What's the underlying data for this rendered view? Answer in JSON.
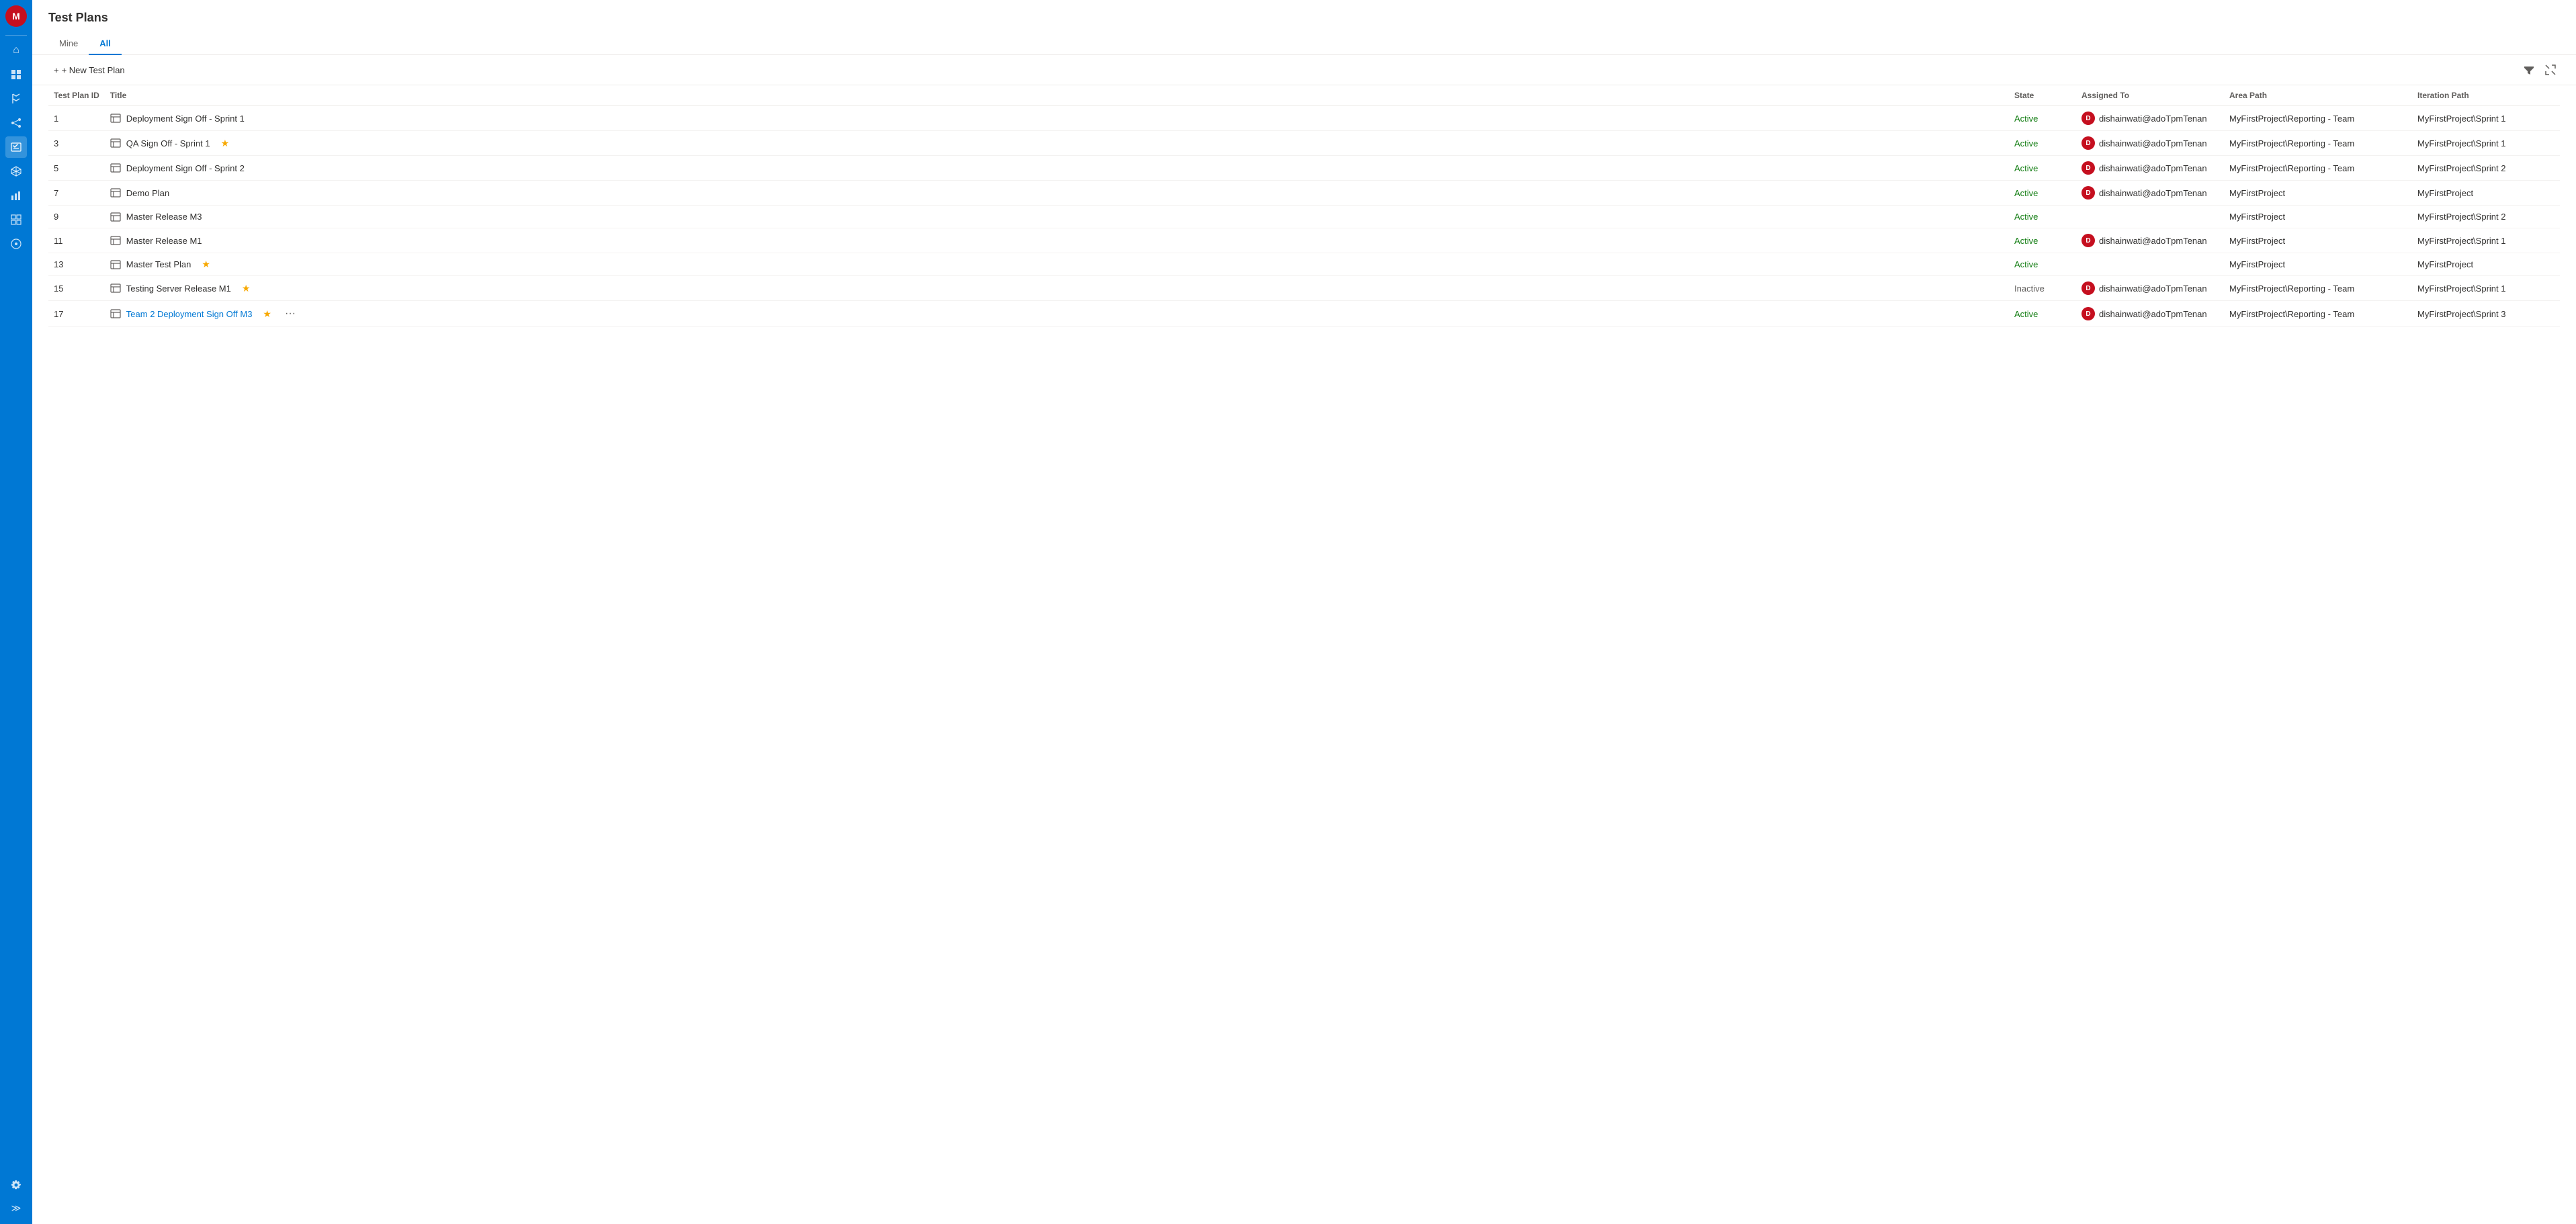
{
  "app": {
    "avatar_initials": "M",
    "page_title": "Test Plans"
  },
  "nav": {
    "icons": [
      {
        "name": "home-icon",
        "symbol": "⌂",
        "active": false
      },
      {
        "name": "boards-icon",
        "symbol": "▦",
        "active": false
      },
      {
        "name": "repos-icon",
        "symbol": "◈",
        "active": false
      },
      {
        "name": "pipelines-icon",
        "symbol": "⚙",
        "active": false
      },
      {
        "name": "testplans-icon",
        "symbol": "✓",
        "active": true
      },
      {
        "name": "artifacts-icon",
        "symbol": "⬡",
        "active": false
      },
      {
        "name": "reports-icon",
        "symbol": "⊞",
        "active": false
      },
      {
        "name": "overview-icon",
        "symbol": "⊟",
        "active": false
      },
      {
        "name": "wiki-icon",
        "symbol": "⊕",
        "active": false
      }
    ],
    "bottom_icons": [
      {
        "name": "settings-icon",
        "symbol": "⚙"
      },
      {
        "name": "expand-icon",
        "symbol": "≫"
      }
    ]
  },
  "tabs": [
    {
      "label": "Mine",
      "active": false
    },
    {
      "label": "All",
      "active": true
    }
  ],
  "toolbar": {
    "new_plan_label": "+ New Test Plan",
    "filter_icon": "≡",
    "expand_icon": "⤢"
  },
  "table": {
    "columns": [
      {
        "key": "id",
        "label": "Test Plan ID"
      },
      {
        "key": "title",
        "label": "Title"
      },
      {
        "key": "state",
        "label": "State"
      },
      {
        "key": "assigned_to",
        "label": "Assigned To"
      },
      {
        "key": "area_path",
        "label": "Area Path"
      },
      {
        "key": "iteration_path",
        "label": "Iteration Path"
      }
    ],
    "rows": [
      {
        "id": "1",
        "title": "Deployment Sign Off - Sprint 1",
        "is_link": false,
        "starred": false,
        "state": "Active",
        "state_class": "state-active",
        "assigned_to": "dishainwati@adoTpmTenan",
        "has_avatar": true,
        "avatar_initials": "D",
        "area_path": "MyFirstProject\\Reporting - Team",
        "iteration_path": "MyFirstProject\\Sprint 1"
      },
      {
        "id": "3",
        "title": "QA Sign Off - Sprint 1",
        "is_link": false,
        "starred": true,
        "state": "Active",
        "state_class": "state-active",
        "assigned_to": "dishainwati@adoTpmTenan",
        "has_avatar": true,
        "avatar_initials": "D",
        "area_path": "MyFirstProject\\Reporting - Team",
        "iteration_path": "MyFirstProject\\Sprint 1"
      },
      {
        "id": "5",
        "title": "Deployment Sign Off - Sprint 2",
        "is_link": false,
        "starred": false,
        "state": "Active",
        "state_class": "state-active",
        "assigned_to": "dishainwati@adoTpmTenan",
        "has_avatar": true,
        "avatar_initials": "D",
        "area_path": "MyFirstProject\\Reporting - Team",
        "iteration_path": "MyFirstProject\\Sprint 2"
      },
      {
        "id": "7",
        "title": "Demo Plan",
        "is_link": false,
        "starred": false,
        "state": "Active",
        "state_class": "state-active",
        "assigned_to": "dishainwati@adoTpmTenan",
        "has_avatar": true,
        "avatar_initials": "D",
        "area_path": "MyFirstProject",
        "iteration_path": "MyFirstProject"
      },
      {
        "id": "9",
        "title": "Master Release M3",
        "is_link": false,
        "starred": false,
        "state": "Active",
        "state_class": "state-active",
        "assigned_to": "",
        "has_avatar": false,
        "avatar_initials": "",
        "area_path": "MyFirstProject",
        "iteration_path": "MyFirstProject\\Sprint 2"
      },
      {
        "id": "11",
        "title": "Master Release M1",
        "is_link": false,
        "starred": false,
        "state": "Active",
        "state_class": "state-active",
        "assigned_to": "dishainwati@adoTpmTenan",
        "has_avatar": true,
        "avatar_initials": "D",
        "area_path": "MyFirstProject",
        "iteration_path": "MyFirstProject\\Sprint 1"
      },
      {
        "id": "13",
        "title": "Master Test Plan",
        "is_link": false,
        "starred": true,
        "state": "Active",
        "state_class": "state-active",
        "assigned_to": "",
        "has_avatar": false,
        "avatar_initials": "",
        "area_path": "MyFirstProject",
        "iteration_path": "MyFirstProject"
      },
      {
        "id": "15",
        "title": "Testing Server Release M1",
        "is_link": false,
        "starred": true,
        "state": "Inactive",
        "state_class": "state-inactive",
        "assigned_to": "dishainwati@adoTpmTenan",
        "has_avatar": true,
        "avatar_initials": "D",
        "area_path": "MyFirstProject\\Reporting - Team",
        "iteration_path": "MyFirstProject\\Sprint 1"
      },
      {
        "id": "17",
        "title": "Team 2 Deployment Sign Off M3",
        "is_link": true,
        "starred": true,
        "has_dots": true,
        "state": "Active",
        "state_class": "state-active",
        "assigned_to": "dishainwati@adoTpmTenan",
        "has_avatar": true,
        "avatar_initials": "D",
        "area_path": "MyFirstProject\\Reporting - Team",
        "iteration_path": "MyFirstProject\\Sprint 3"
      }
    ]
  }
}
